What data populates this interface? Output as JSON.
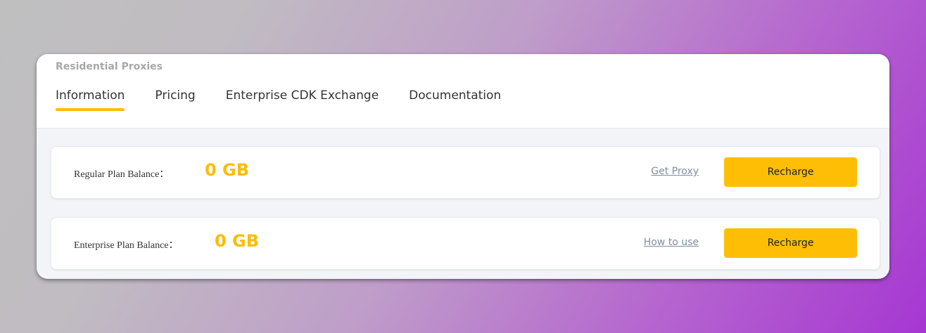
{
  "header": {
    "section_title": "Residential Proxies",
    "tabs": [
      {
        "label": "Information",
        "active": true
      },
      {
        "label": "Pricing",
        "active": false
      },
      {
        "label": "Enterprise CDK Exchange",
        "active": false
      },
      {
        "label": "Documentation",
        "active": false
      }
    ]
  },
  "balances": [
    {
      "label": "Regular Plan Balance：",
      "value": "0 GB",
      "link_text": "Get Proxy",
      "button_label": "Recharge"
    },
    {
      "label": "Enterprise Plan Balance：",
      "value": "0 GB",
      "link_text": "How to use",
      "button_label": "Recharge"
    }
  ],
  "colors": {
    "accent": "#fbbd08",
    "link": "#7f8ea3"
  }
}
